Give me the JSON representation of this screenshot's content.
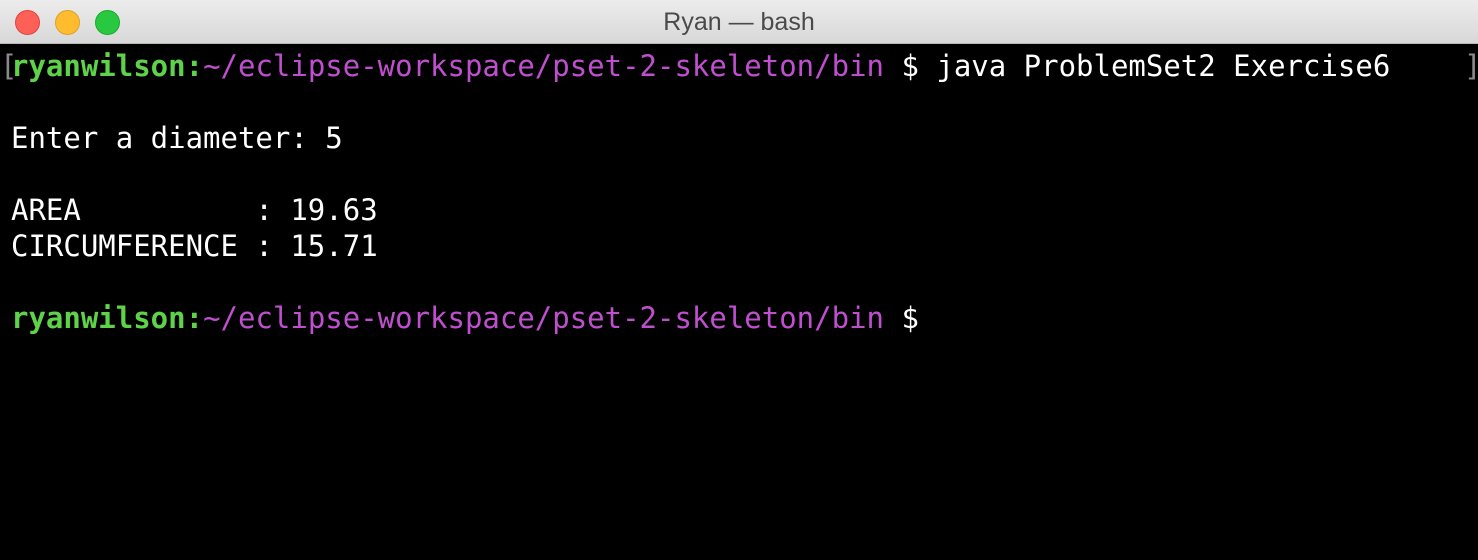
{
  "window": {
    "title": "Ryan — bash"
  },
  "terminal": {
    "line1": {
      "user": "ryanwilson:",
      "path": "~/eclipse-workspace/pset-2-skeleton/bin",
      "command": " $ java ProblemSet2 Exercise6"
    },
    "line2": "Enter a diameter: 5",
    "line3": "AREA          : 19.63",
    "line4": "CIRCUMFERENCE : 15.71",
    "line5": {
      "user": "ryanwilson:",
      "path": "~/eclipse-workspace/pset-2-skeleton/bin",
      "prompt": " $"
    }
  },
  "colors": {
    "user": "#5ed34a",
    "path": "#c04fd0",
    "text": "#ffffff",
    "background": "#000000"
  }
}
